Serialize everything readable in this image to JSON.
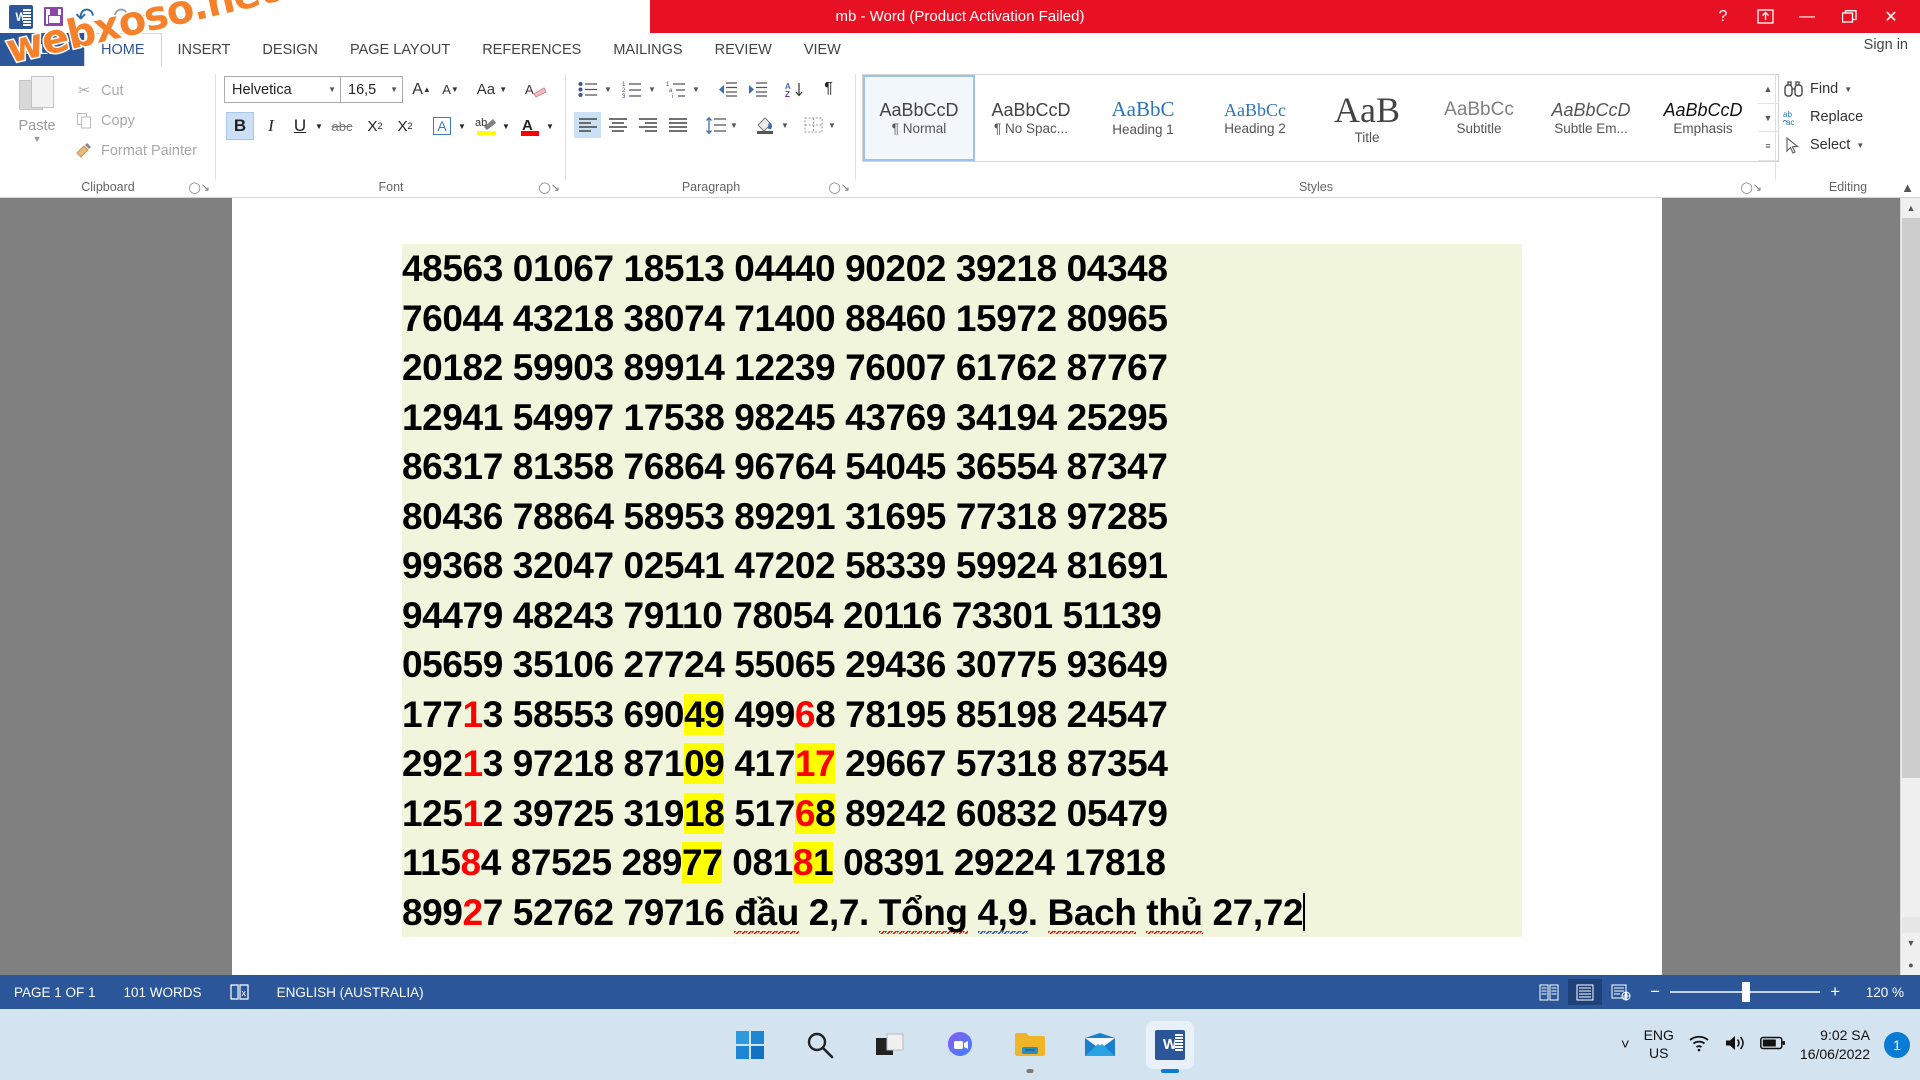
{
  "window": {
    "title": "mb -  Word (Product Activation Failed)",
    "help_icon": "help-icon",
    "ribbon_display_icon": "ribbon-display-options-icon",
    "minimize_icon": "minimize-icon",
    "restore_icon": "restore-icon",
    "close_icon": "close-icon",
    "sign_in": "Sign in"
  },
  "watermark": {
    "text": "webxoso.net"
  },
  "quick_access": {
    "app_icon": "word-app-icon",
    "save": "save-icon",
    "undo": "undo-icon",
    "redo": "redo-icon",
    "customize": "customize-quick-access-toolbar-icon"
  },
  "tabs": [
    {
      "label": "FILE",
      "active": false
    },
    {
      "label": "HOME",
      "active": true
    },
    {
      "label": "INSERT",
      "active": false
    },
    {
      "label": "DESIGN",
      "active": false
    },
    {
      "label": "PAGE LAYOUT",
      "active": false
    },
    {
      "label": "REFERENCES",
      "active": false
    },
    {
      "label": "MAILINGS",
      "active": false
    },
    {
      "label": "REVIEW",
      "active": false
    },
    {
      "label": "VIEW",
      "active": false
    }
  ],
  "ribbon": {
    "clipboard": {
      "group_label": "Clipboard",
      "paste": "Paste",
      "cut": "Cut",
      "copy": "Copy",
      "format_painter": "Format Painter"
    },
    "font": {
      "group_label": "Font",
      "font_name": "Helvetica",
      "font_size": "16,5",
      "grow_font": "A",
      "shrink_font": "A",
      "change_case": "Aa",
      "clear_formatting": "clear-formatting-icon",
      "bold": "B",
      "italic": "I",
      "underline": "U",
      "strikethrough": "abc",
      "subscript": "X",
      "superscript": "X",
      "text_effects": "A",
      "highlight": "highlight-color-icon",
      "font_color": "A",
      "bold_active": true
    },
    "paragraph": {
      "group_label": "Paragraph",
      "bullets": "bullets-icon",
      "numbering": "numbering-icon",
      "multilevel": "multilevel-list-icon",
      "decrease_indent": "decrease-indent-icon",
      "increase_indent": "increase-indent-icon",
      "sort": "sort-icon",
      "show_marks": "show-formatting-marks-icon",
      "align_left": "align-left-icon",
      "align_center": "align-center-icon",
      "align_right": "align-right-icon",
      "justify": "justify-icon",
      "line_spacing": "line-spacing-icon",
      "shading": "shading-icon",
      "borders": "borders-icon",
      "align_left_active": true
    },
    "styles": {
      "group_label": "Styles",
      "items": [
        {
          "preview": "AaBbCcD",
          "name": "¶ Normal",
          "style": "normal",
          "selected": true
        },
        {
          "preview": "AaBbCcD",
          "name": "¶ No Spac...",
          "style": "nospacing",
          "selected": false
        },
        {
          "preview": "AaBbC",
          "name": "Heading 1",
          "style": "h1",
          "selected": false
        },
        {
          "preview": "AaBbCc",
          "name": "Heading 2",
          "style": "h2",
          "selected": false
        },
        {
          "preview": "AaB",
          "name": "Title",
          "style": "title",
          "selected": false
        },
        {
          "preview": "AaBbCc",
          "name": "Subtitle",
          "style": "subtitle",
          "selected": false
        },
        {
          "preview": "AaBbCcD",
          "name": "Subtle Em...",
          "style": "subtleem",
          "selected": false
        },
        {
          "preview": "AaBbCcD",
          "name": "Emphasis",
          "style": "emphasis",
          "selected": false
        }
      ],
      "scroll_up": "▲",
      "scroll_down": "▼",
      "more": "≡"
    },
    "editing": {
      "group_label": "Editing",
      "find": "Find",
      "replace": "Replace",
      "select": "Select",
      "find_icon": "find-binoculars-icon",
      "replace_icon": "replace-icon",
      "select_icon": "select-pointer-icon"
    },
    "collapse_ribbon": "collapse-ribbon-icon"
  },
  "document": {
    "lines": [
      {
        "segments": [
          {
            "t": "48563 01067 18513 04440 90202 39218 04348"
          }
        ]
      },
      {
        "segments": [
          {
            "t": "76044 43218 38074 71400 88460 15972 80965"
          }
        ]
      },
      {
        "segments": [
          {
            "t": "20182 59903 89914 12239 76007 61762 87767"
          }
        ]
      },
      {
        "segments": [
          {
            "t": "12941 54997 17538 98245 43769 34194 25295"
          }
        ]
      },
      {
        "segments": [
          {
            "t": "86317 81358 76864 96764 54045 36554 87347"
          }
        ]
      },
      {
        "segments": [
          {
            "t": "80436 78864 58953 89291 31695 77318 97285"
          }
        ]
      },
      {
        "segments": [
          {
            "t": "99368 32047 02541 47202 58339 59924 81691"
          }
        ]
      },
      {
        "segments": [
          {
            "t": "94479 48243 79110 78054 20116 73301 51139"
          }
        ]
      },
      {
        "segments": [
          {
            "t": "05659 35106 27724 55065 29436 30775 93649"
          }
        ]
      },
      {
        "segments": [
          {
            "t": "177"
          },
          {
            "t": "1",
            "c": "red"
          },
          {
            "t": "3 58553 690"
          },
          {
            "t": "49",
            "h": true
          },
          {
            "t": " 499"
          },
          {
            "t": "6",
            "c": "red"
          },
          {
            "t": "8 78195 85198 24547"
          }
        ]
      },
      {
        "segments": [
          {
            "t": "292"
          },
          {
            "t": "1",
            "c": "red"
          },
          {
            "t": "3 97218 871"
          },
          {
            "t": "09",
            "h": true
          },
          {
            "t": " 417"
          },
          {
            "t": "17",
            "c": "red",
            "h": true
          },
          {
            "t": " 29667 57318 87354"
          }
        ]
      },
      {
        "segments": [
          {
            "t": "125"
          },
          {
            "t": "1",
            "c": "red"
          },
          {
            "t": "2 39725 319"
          },
          {
            "t": "18",
            "h": true
          },
          {
            "t": " 517"
          },
          {
            "t": "6",
            "c": "red",
            "h": true
          },
          {
            "t": "8",
            "h": true
          },
          {
            "t": " 89242 60832 05479"
          }
        ]
      },
      {
        "segments": [
          {
            "t": "115"
          },
          {
            "t": "8",
            "c": "red"
          },
          {
            "t": "4 87525 289"
          },
          {
            "t": "77",
            "h": true
          },
          {
            "t": " 081"
          },
          {
            "t": "8",
            "c": "red",
            "h": true
          },
          {
            "t": "1",
            "h": true
          },
          {
            "t": " 08391 29224 17818"
          }
        ]
      },
      {
        "segments": [
          {
            "t": "899"
          },
          {
            "t": "2",
            "c": "red"
          },
          {
            "t": "7 52762 79716 "
          },
          {
            "t": "đầu",
            "s": "red-wavy"
          },
          {
            "t": " 2,7. "
          },
          {
            "t": "Tổng",
            "s": "red-wavy"
          },
          {
            "t": " "
          },
          {
            "t": "4,9",
            "s": "blue-wavy"
          },
          {
            "t": ". "
          },
          {
            "t": "Bach",
            "s": "red-wavy"
          },
          {
            "t": " "
          },
          {
            "t": "thủ",
            "s": "red-wavy"
          },
          {
            "t": " 27,72"
          },
          {
            "t": "",
            "caret": true
          }
        ]
      }
    ],
    "highlight_color": "#FFFF00",
    "shading_color": "#F0F5DC",
    "red_color": "#FF0000"
  },
  "status_bar": {
    "page": "PAGE 1 OF 1",
    "words": "101 WORDS",
    "proofing_icon": "proofing-errors-icon",
    "language": "ENGLISH (AUSTRALIA)",
    "read_mode_icon": "read-mode-icon",
    "print_layout_icon": "print-layout-icon",
    "web_layout_icon": "web-layout-icon",
    "zoom_out": "−",
    "zoom_in": "+",
    "zoom_level": "120 %"
  },
  "taskbar": {
    "items": [
      {
        "name": "start-button",
        "icon": "windows-logo-icon"
      },
      {
        "name": "search-button",
        "icon": "search-icon"
      },
      {
        "name": "task-view-button",
        "icon": "task-view-icon"
      },
      {
        "name": "chat-button",
        "icon": "teams-chat-icon"
      },
      {
        "name": "file-explorer-button",
        "icon": "folder-icon",
        "running": true
      },
      {
        "name": "mail-button",
        "icon": "mail-envelope-icon"
      },
      {
        "name": "word-taskbar-button",
        "icon": "word-app-icon",
        "active": true
      }
    ],
    "tray": {
      "show_hidden_icons": "chevron-up-icon",
      "language": "ENG",
      "language_sub": "US",
      "wifi_icon": "wifi-icon",
      "volume_icon": "volume-icon",
      "battery_icon": "battery-icon",
      "time": "9:02 SA",
      "date": "16/06/2022",
      "notification_count": "1"
    }
  }
}
